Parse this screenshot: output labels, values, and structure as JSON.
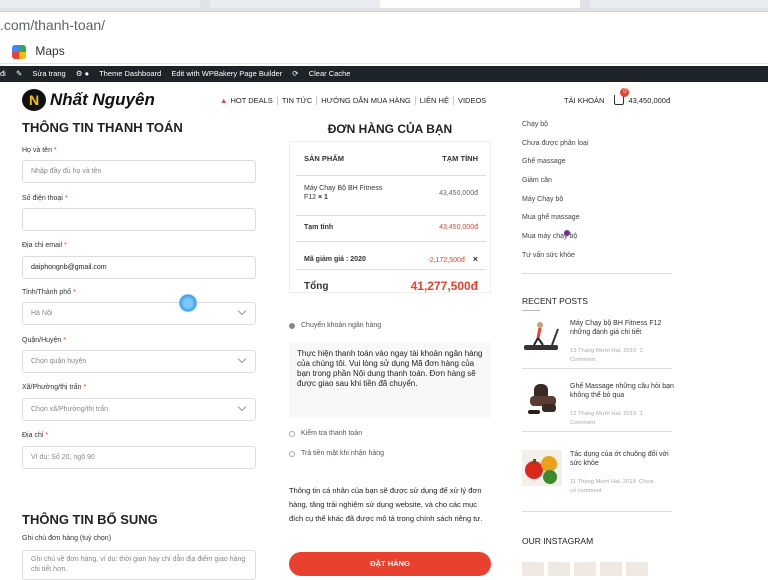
{
  "browser": {
    "url": ".com/thanh-toan/",
    "bookmark": "Maps"
  },
  "adminbar": {
    "items": [
      "đi",
      "Sửa trang",
      "Theme Dashboard",
      "Edit with WPBakery Page Builder",
      "Clear Cache"
    ]
  },
  "header": {
    "logo": "Nhất Nguyên",
    "nav": [
      "HOT DEALS",
      "TIN TỨC",
      "HƯỚNG DẪN MUA HÀNG",
      "LIÊN HỆ",
      "VIDEOS"
    ],
    "account": "TÀI KHOẢN",
    "cart_count": "0",
    "cart_total": "43,450,000đ"
  },
  "billing": {
    "title": "THÔNG TIN THANH TOÁN",
    "fullname_label": "Họ và tên",
    "fullname_placeholder": "Nhập đầy đủ họ và tên",
    "phone_label": "Số điện thoại",
    "email_label": "Địa chỉ email",
    "email_value": "daiphongnb@gmail.com",
    "province_label": "Tỉnh/Thành phố",
    "province_value": "Hà Nội",
    "district_label": "Quận/Huyện",
    "district_value": "Chọn quận huyện",
    "ward_label": "Xã/Phường/thị trấn",
    "ward_value": "Chọn xã/Phường/thị trấn",
    "address_label": "Địa chỉ",
    "address_placeholder": "Ví dụ: Số 20, ngõ 90",
    "extra_title": "THÔNG TIN BỔ SUNG",
    "note_label": "Ghi chú đơn hàng (tuỳ chọn)",
    "note_placeholder": "Ghi chú về đơn hàng, ví dụ: thời gian hay chỉ dẫn địa điểm giao hàng chi tiết hơn."
  },
  "order": {
    "title": "ĐƠN HÀNG CỦA BẠN",
    "col_product": "SẢN PHẨM",
    "col_subtotal": "TẠM TÍNH",
    "product_name": "Máy Chạy Bộ BH Fitness F12",
    "product_qty": "× 1",
    "product_price": "43,450,000đ",
    "subtotal_label": "Tạm tính",
    "subtotal_value": "43,450,000đ",
    "coupon_label": "Mã giảm giá : 2020",
    "coupon_value": "-2,172,500đ",
    "coupon_remove": "×",
    "total_label": "Tổng",
    "total_value": "41,277,500đ",
    "pay_bank": "Chuyển khoản ngân hàng",
    "pay_bank_desc": "Thực hiện thanh toán vào ngay tài khoản ngân hàng của chúng tôi. Vui lòng sử dụng Mã đơn hàng của bạn trong phần Nội dung thanh toán. Đơn hàng sẽ được giao sau khi tiền đã chuyển.",
    "pay_check": "Kiểm tra thanh toán",
    "pay_cod": "Trả tiền mặt khi nhận hàng",
    "privacy": "Thông tin cá nhân của bạn sẽ được sử dụng để xử lý đơn hàng, tăng trải nghiệm sử dụng website, và cho các mục đích cụ thể khác đã được mô tả trong chính sách riêng tư.",
    "submit": "ĐẶT HÀNG"
  },
  "sidebar": {
    "categories": [
      "Chạy bộ",
      "Chưa được phân loại",
      "Ghế massage",
      "Giảm cân",
      "Máy Chạy bộ",
      "Mua ghế massage",
      "Mua máy chạy bộ",
      "Tư vấn sức khỏe"
    ],
    "recent_title": "RECENT POSTS",
    "posts": [
      {
        "title": "Máy Chạy bộ BH Fitness F12 những đánh giá chi tiết",
        "meta": "13 Tháng Mười Hai, 2019",
        "count": "1",
        "comment": "Comment"
      },
      {
        "title": "Ghế Massage những câu hỏi bạn không thể bỏ qua",
        "meta": "12 Tháng Mười Hai, 2019",
        "count": "1",
        "comment": "Comment"
      },
      {
        "title": "Tác dụng của ớt chuông đối với sức khỏe",
        "meta": "11 Tháng Mười Hai, 2019",
        "count": "Chưa",
        "comment": "có comment"
      }
    ],
    "insta_title": "OUR INSTAGRAM"
  }
}
